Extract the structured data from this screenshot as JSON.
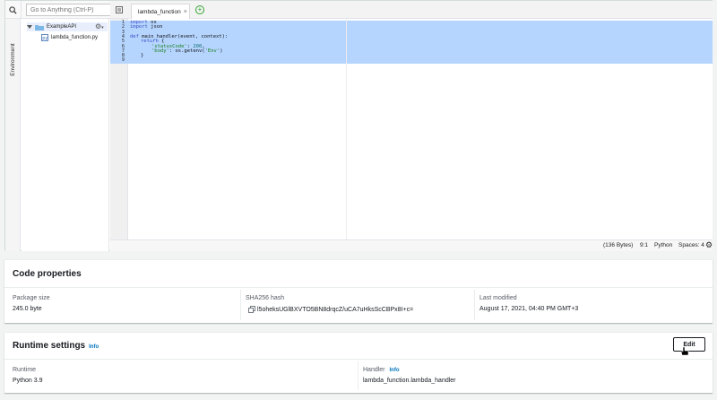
{
  "ide": {
    "search_placeholder": "Go to Anything (Ctrl-P)",
    "side_tab_label": "Environment",
    "tree": {
      "root_folder": "ExampleAPI",
      "file": "lambda_function.py"
    },
    "tab": {
      "label": "lambda_function",
      "close": "×"
    },
    "add_tab": "+",
    "line_numbers": [
      "1",
      "2",
      "3",
      "4",
      "5",
      "6",
      "7",
      "8",
      "9"
    ],
    "code": {
      "l1_kw": "import",
      "l1_rest": " os",
      "l2_kw": "import",
      "l2_rest": " json",
      "l4_kw": "def",
      "l4_rest": " main_handler(event, context):",
      "l5_kw": "return",
      "l5_rest": " {",
      "l6_str": "'statusCode'",
      "l6_colon": ": ",
      "l6_num": "200",
      "l6_comma": ",",
      "l7_str1": "'body'",
      "l7_mid": ": os.getenv(",
      "l7_str2": "'Env'",
      "l7_end": ")",
      "l8": "}"
    },
    "status": {
      "bytes": "(136 Bytes)",
      "position": "9:1",
      "language": "Python",
      "spaces": "Spaces: 4"
    }
  },
  "code_properties": {
    "title": "Code properties",
    "package_size_label": "Package size",
    "package_size_value": "245.0 byte",
    "sha_label": "SHA256 hash",
    "sha_value": "l5oheksUGlBXVTO5BN8drqcZ/uCA7uHksScCBPx8I+c=",
    "last_modified_label": "Last modified",
    "last_modified_value": "August 17, 2021, 04:40 PM GMT+3"
  },
  "runtime_settings": {
    "title": "Runtime settings",
    "info": "Info",
    "edit_button": "Edit",
    "runtime_label": "Runtime",
    "runtime_value": "Python 3.9",
    "handler_label": "Handler",
    "handler_info": "Info",
    "handler_value": "lambda_function.lambda_handler"
  },
  "colors": {
    "selection": "#b5d5ff",
    "link": "#0073bb",
    "add_tab": "#2fa32f",
    "accent_strip": "#e07941"
  },
  "icons": [
    "search-icon",
    "folder-icon",
    "python-file-icon",
    "gear-icon",
    "tab-menu-icon",
    "add-tab-icon",
    "copy-icon",
    "settings-icon",
    "mouse-cursor-icon"
  ]
}
